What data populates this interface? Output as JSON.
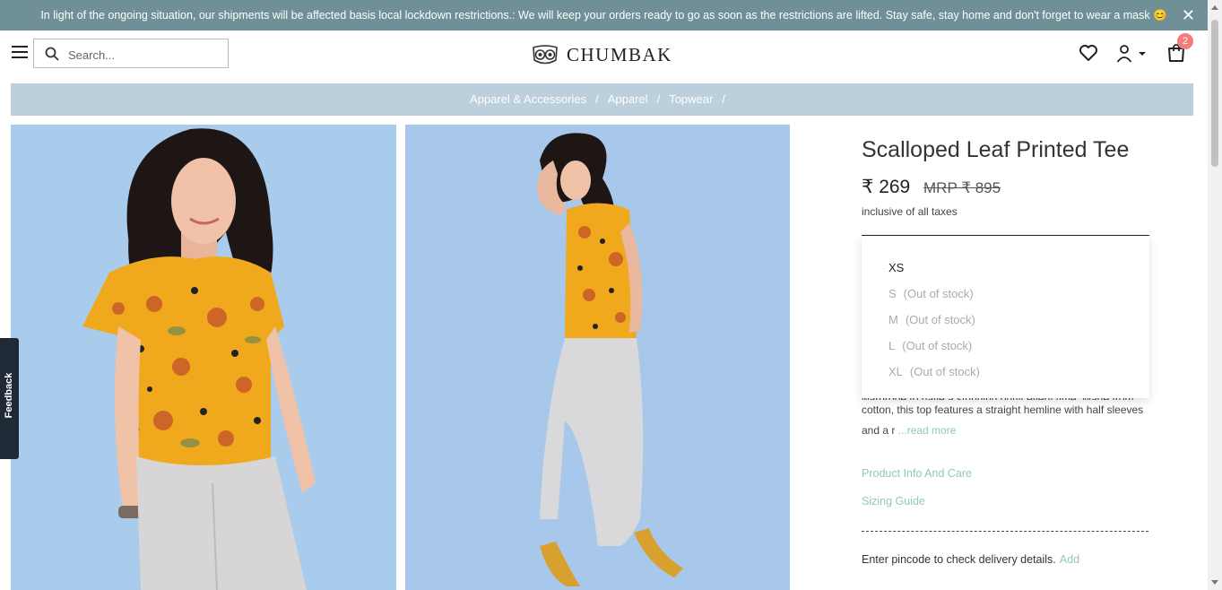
{
  "announcement": {
    "text": "In light of the ongoing situation, our shipments will be affected basis local lockdown restrictions.: We will keep your orders ready to go as soon as the restrictions are lifted. Stay safe, stay home and don't forget to wear a mask 😊",
    "close": "✕"
  },
  "header": {
    "search_placeholder": "Search...",
    "brand": "CHUMBAK",
    "cart_count": "2"
  },
  "breadcrumb": {
    "items": [
      {
        "label": "Apparel & Accessories"
      },
      {
        "label": "Apparel"
      },
      {
        "label": "Topwear"
      }
    ],
    "separator": "/"
  },
  "feedback": {
    "label": "Feedback"
  },
  "product": {
    "title": "Scalloped Leaf Printed Tee",
    "price": "₹ 269",
    "mrp": "MRP ₹ 895",
    "taxes": "inclusive of all taxes",
    "sizes": [
      {
        "label": "XS",
        "status": ""
      },
      {
        "label": "S",
        "status": "(Out of stock)"
      },
      {
        "label": "M",
        "status": "(Out of stock)"
      },
      {
        "label": "L",
        "status": "(Out of stock)"
      },
      {
        "label": "XL",
        "status": "(Out of stock)"
      }
    ],
    "description_clipped": "wardrobe to have a stunning outfit every time. Made from",
    "description_line2": "cotton, this top features a straight hemline with half sleeves",
    "description_line3": "and a r",
    "read_more": "...read more",
    "info_care": "Product Info And Care",
    "sizing_guide": "Sizing Guide",
    "pincode_text": "Enter pincode to check delivery details.",
    "pincode_add": "Add"
  },
  "colors": {
    "announcement_bg": "#6f9097",
    "breadcrumb_bg": "#bccfdc",
    "accent_mint": "#8fc9bf",
    "badge": "#f47c7c",
    "photo_bg": "#a9cbec",
    "tee_yellow": "#f0a81c"
  }
}
